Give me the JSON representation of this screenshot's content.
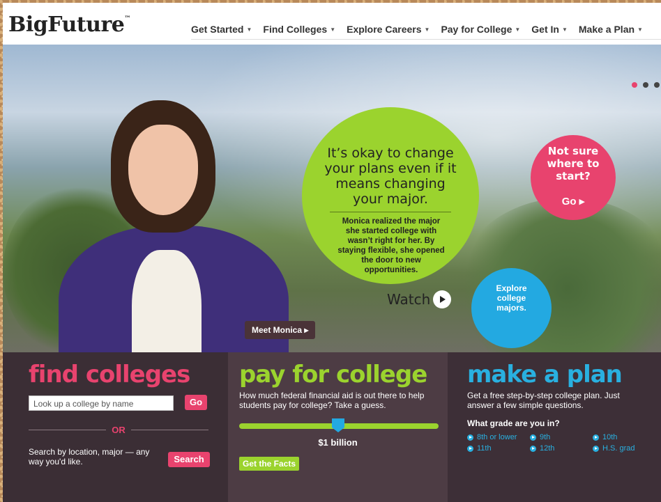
{
  "header": {
    "logo": "BigFuture",
    "logo_tm": "™",
    "nav": [
      {
        "label": "Get Started"
      },
      {
        "label": "Find Colleges"
      },
      {
        "label": "Explore Careers"
      },
      {
        "label": "Pay for College"
      },
      {
        "label": "Get In"
      },
      {
        "label": "Make a Plan"
      }
    ]
  },
  "hero": {
    "slide_dots": 3,
    "active_dot": 1,
    "green_circle": {
      "headline": "It’s okay to change your plans even if it means changing your major.",
      "body": "Monica realized the major she started college with wasn’t right for her. By staying flexible, she opened the door to new opportunities.",
      "watch_label": "Watch",
      "color": "#9bd32e"
    },
    "pink_circle": {
      "text": "Not sure where to start?",
      "go_label": "Go ▸",
      "color": "#e8436e"
    },
    "blue_circle": {
      "text": "Explore college majors.",
      "color": "#23a9e1"
    },
    "meet_label": "Meet Monica ▸"
  },
  "find_colleges": {
    "title": "find colleges",
    "input_placeholder": "Look up a college by name",
    "go_label": "Go",
    "or_label": "OR",
    "desc": "Search by location, major — any way you'd like.",
    "search_label": "Search"
  },
  "pay_for_college": {
    "title": "pay for college",
    "desc": "How much federal financial aid is out there to help students pay for college? Take a guess.",
    "slider_value": "$1 billion",
    "slider_position": 0.5,
    "facts_label": "Get the Facts"
  },
  "make_a_plan": {
    "title": "make a plan",
    "desc": "Get a free step-by-step college plan. Just answer a few simple questions.",
    "question": "What grade are you in?",
    "grades": [
      "8th or lower",
      "9th",
      "10th",
      "11th",
      "12th",
      "H.S. grad"
    ]
  }
}
